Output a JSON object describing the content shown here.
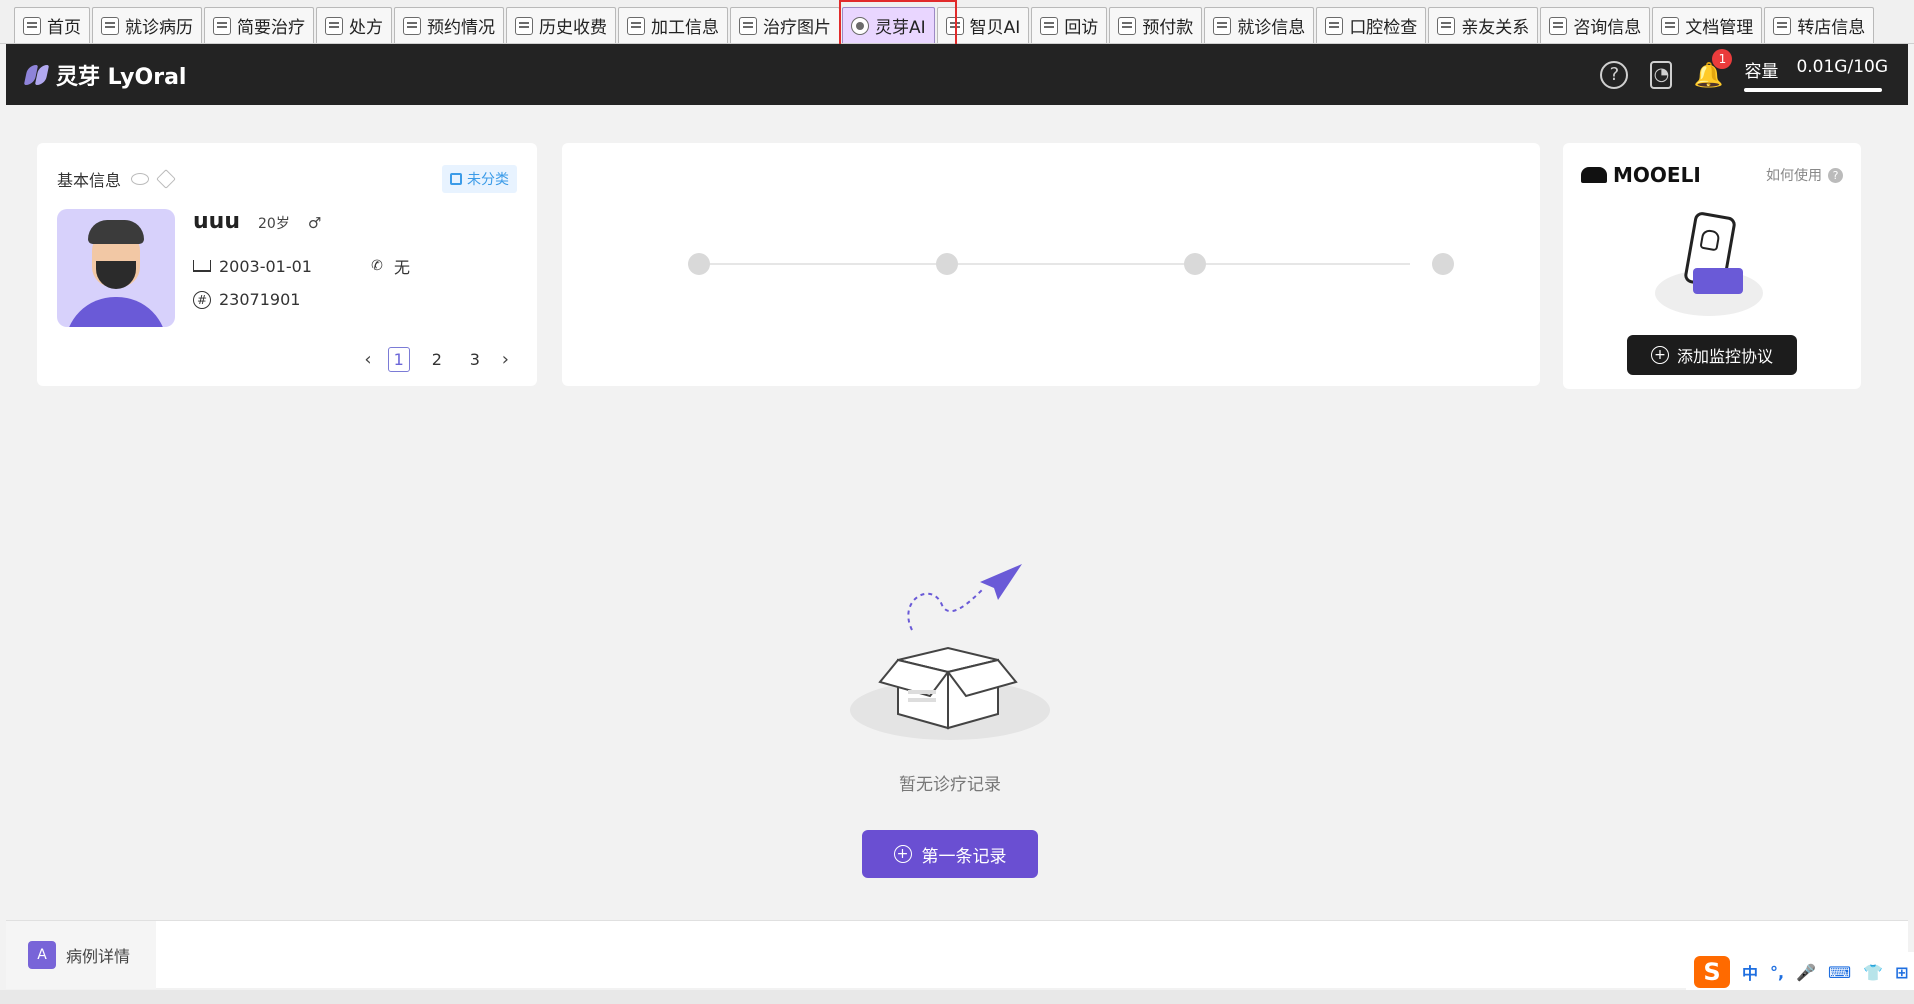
{
  "tabs": [
    {
      "label": "首页"
    },
    {
      "label": "就诊病历"
    },
    {
      "label": "简要治疗"
    },
    {
      "label": "处方"
    },
    {
      "label": "预约情况"
    },
    {
      "label": "历史收费"
    },
    {
      "label": "加工信息"
    },
    {
      "label": "治疗图片"
    },
    {
      "label": "灵芽AI",
      "active": true
    },
    {
      "label": "智贝AI"
    },
    {
      "label": "回访"
    },
    {
      "label": "预付款"
    },
    {
      "label": "就诊信息"
    },
    {
      "label": "口腔检查"
    },
    {
      "label": "亲友关系"
    },
    {
      "label": "咨询信息"
    },
    {
      "label": "文档管理"
    },
    {
      "label": "转店信息"
    }
  ],
  "header": {
    "logo_text": "灵芽 LyOral",
    "notification_count": "1",
    "capacity_label": "容量",
    "capacity_value": "0.01G/10G",
    "icons": [
      "help-icon",
      "document-clock-icon",
      "bell-icon"
    ]
  },
  "patient": {
    "section_title": "基本信息",
    "tag": "未分类",
    "name": "uuu",
    "age": "20岁",
    "gender_symbol": "♂",
    "birthday": "2003-01-01",
    "phone": "无",
    "id": "23071901",
    "pages": [
      "1",
      "2",
      "3"
    ],
    "current_page": "1"
  },
  "mooeli": {
    "logo": "MOOELI",
    "how_to": "如何使用",
    "add_button": "添加监控协议"
  },
  "empty_state": {
    "message": "暂无诊疗记录",
    "button": "第一条记录"
  },
  "bottom": {
    "case_detail": "病例详情"
  },
  "ime": {
    "logo": "S",
    "lang": "中",
    "items": [
      "°,",
      "🎤",
      "⌨",
      "👕",
      "⊞"
    ]
  },
  "colors": {
    "accent": "#6a4fd2",
    "header_bg": "#232323",
    "active_tab": "#e9d6ff",
    "highlight": "#e12b2b"
  }
}
